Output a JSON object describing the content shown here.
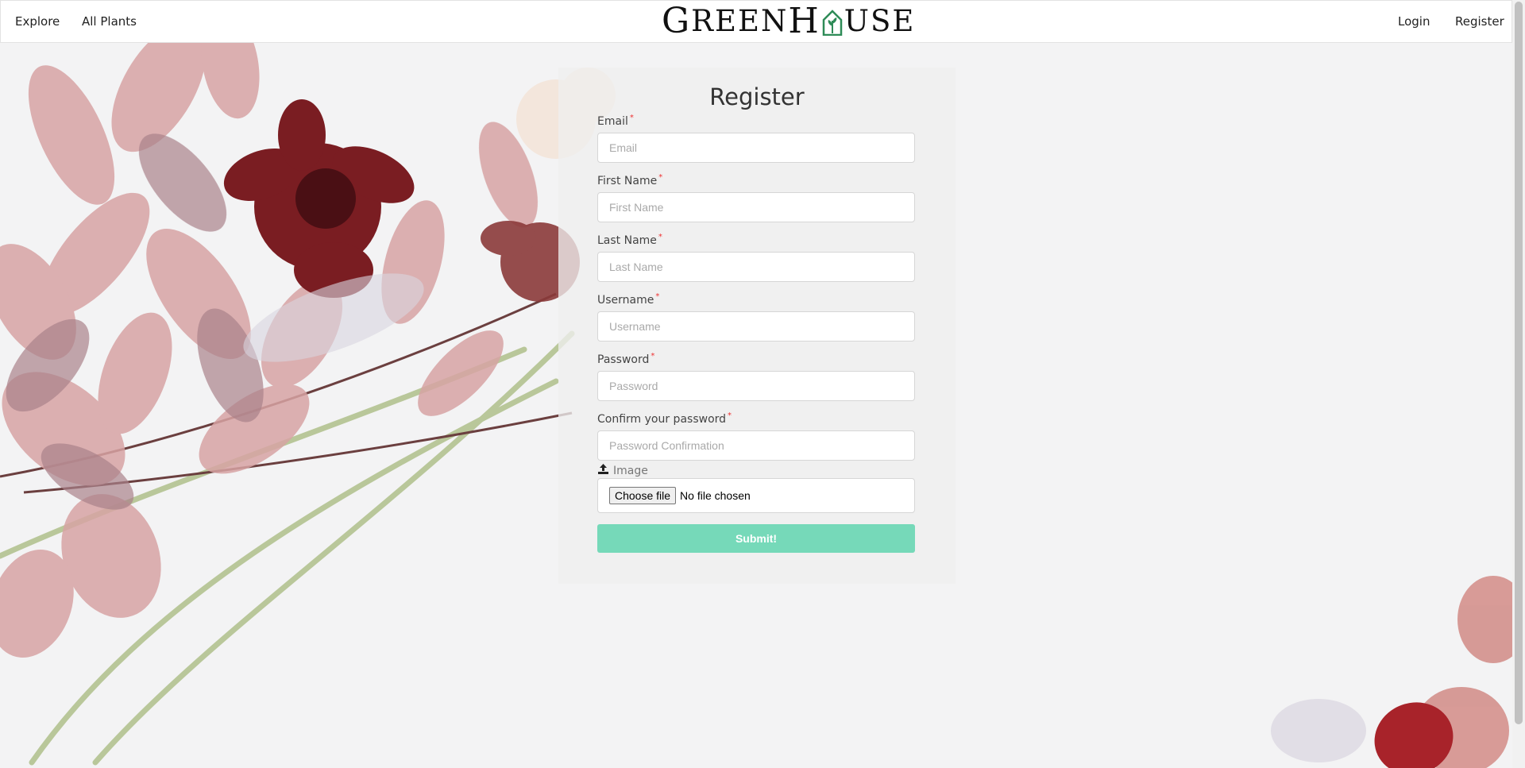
{
  "nav": {
    "explore": "Explore",
    "all_plants": "All Plants",
    "login": "Login",
    "register": "Register",
    "logo_before": "G",
    "logo_mid": "REEN",
    "logo_h": "H",
    "logo_after": "USE"
  },
  "form": {
    "title": "Register",
    "required_mark": "*",
    "fields": [
      {
        "label": "Email",
        "placeholder": "Email",
        "type": "text"
      },
      {
        "label": "First Name",
        "placeholder": "First Name",
        "type": "text"
      },
      {
        "label": "Last Name",
        "placeholder": "Last Name",
        "type": "text"
      },
      {
        "label": "Username",
        "placeholder": "Username",
        "type": "text"
      },
      {
        "label": "Password",
        "placeholder": "Password",
        "type": "password"
      },
      {
        "label": "Confirm your password",
        "placeholder": "Password Confirmation",
        "type": "password"
      }
    ],
    "image_label": "Image",
    "image_icon": "upload-icon",
    "file_button": "Choose file",
    "file_status": "No file chosen",
    "submit": "Submit!"
  },
  "colors": {
    "submit_bg": "#76d9b9",
    "required": "#e33333",
    "logo_house": "#2e8b57"
  }
}
